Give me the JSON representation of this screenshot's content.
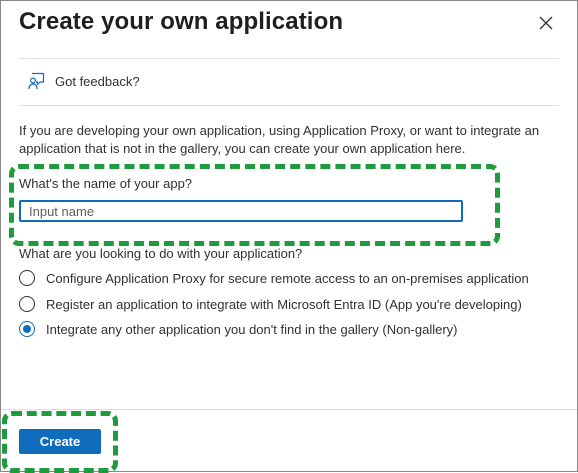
{
  "dialog": {
    "title": "Create your own application",
    "close_icon": "close-icon"
  },
  "feedback": {
    "icon": "feedback-person-icon",
    "label": "Got feedback?"
  },
  "intro_text": "If you are developing your own application, using Application Proxy, or want to integrate an application that is not in the gallery, you can create your own application here.",
  "name_field": {
    "label": "What's the name of your app?",
    "value": "",
    "placeholder": "Input name"
  },
  "purpose": {
    "label": "What are you looking to do with your application?",
    "options": [
      {
        "label": "Configure Application Proxy for secure remote access to an on-premises application",
        "selected": false
      },
      {
        "label": "Register an application to integrate with Microsoft Entra ID (App you're developing)",
        "selected": false
      },
      {
        "label": "Integrate any other application you don't find in the gallery (Non-gallery)",
        "selected": true
      }
    ]
  },
  "footer": {
    "create_label": "Create"
  },
  "colors": {
    "accent": "#0f6cbd",
    "highlight": "#1e9b3c",
    "text": "#323130"
  }
}
